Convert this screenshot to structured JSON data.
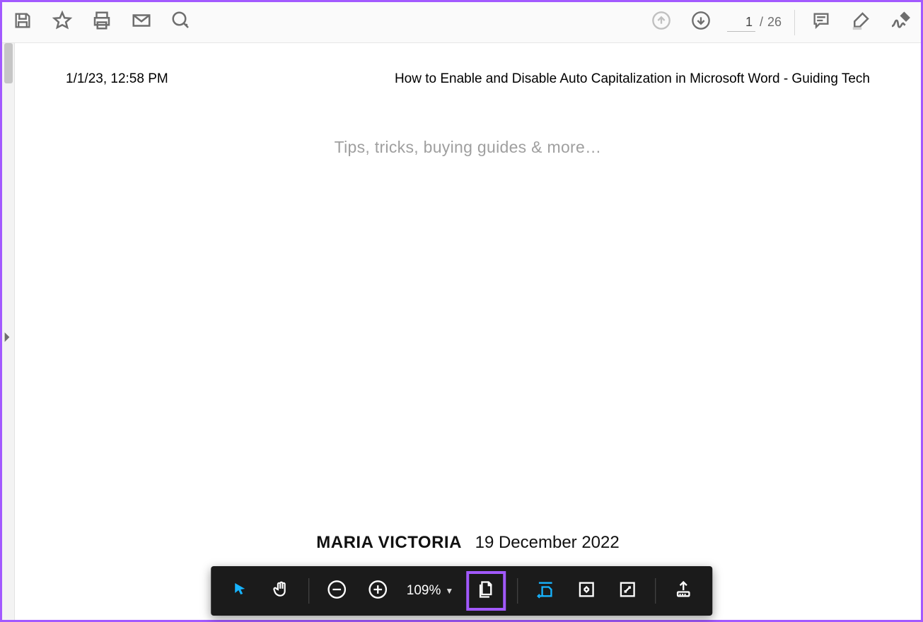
{
  "toolbar": {
    "current_page": "1",
    "page_separator": "/",
    "total_pages": "26"
  },
  "document": {
    "timestamp": "1/1/23, 12:58 PM",
    "header_title": "How to Enable and Disable Auto Capitalization in Microsoft Word - Guiding Tech",
    "tagline": "Tips, tricks, buying guides & more…",
    "author": "MARIA VICTORIA",
    "publish_date": "19 December 2022"
  },
  "floatbar": {
    "zoom": "109%"
  }
}
